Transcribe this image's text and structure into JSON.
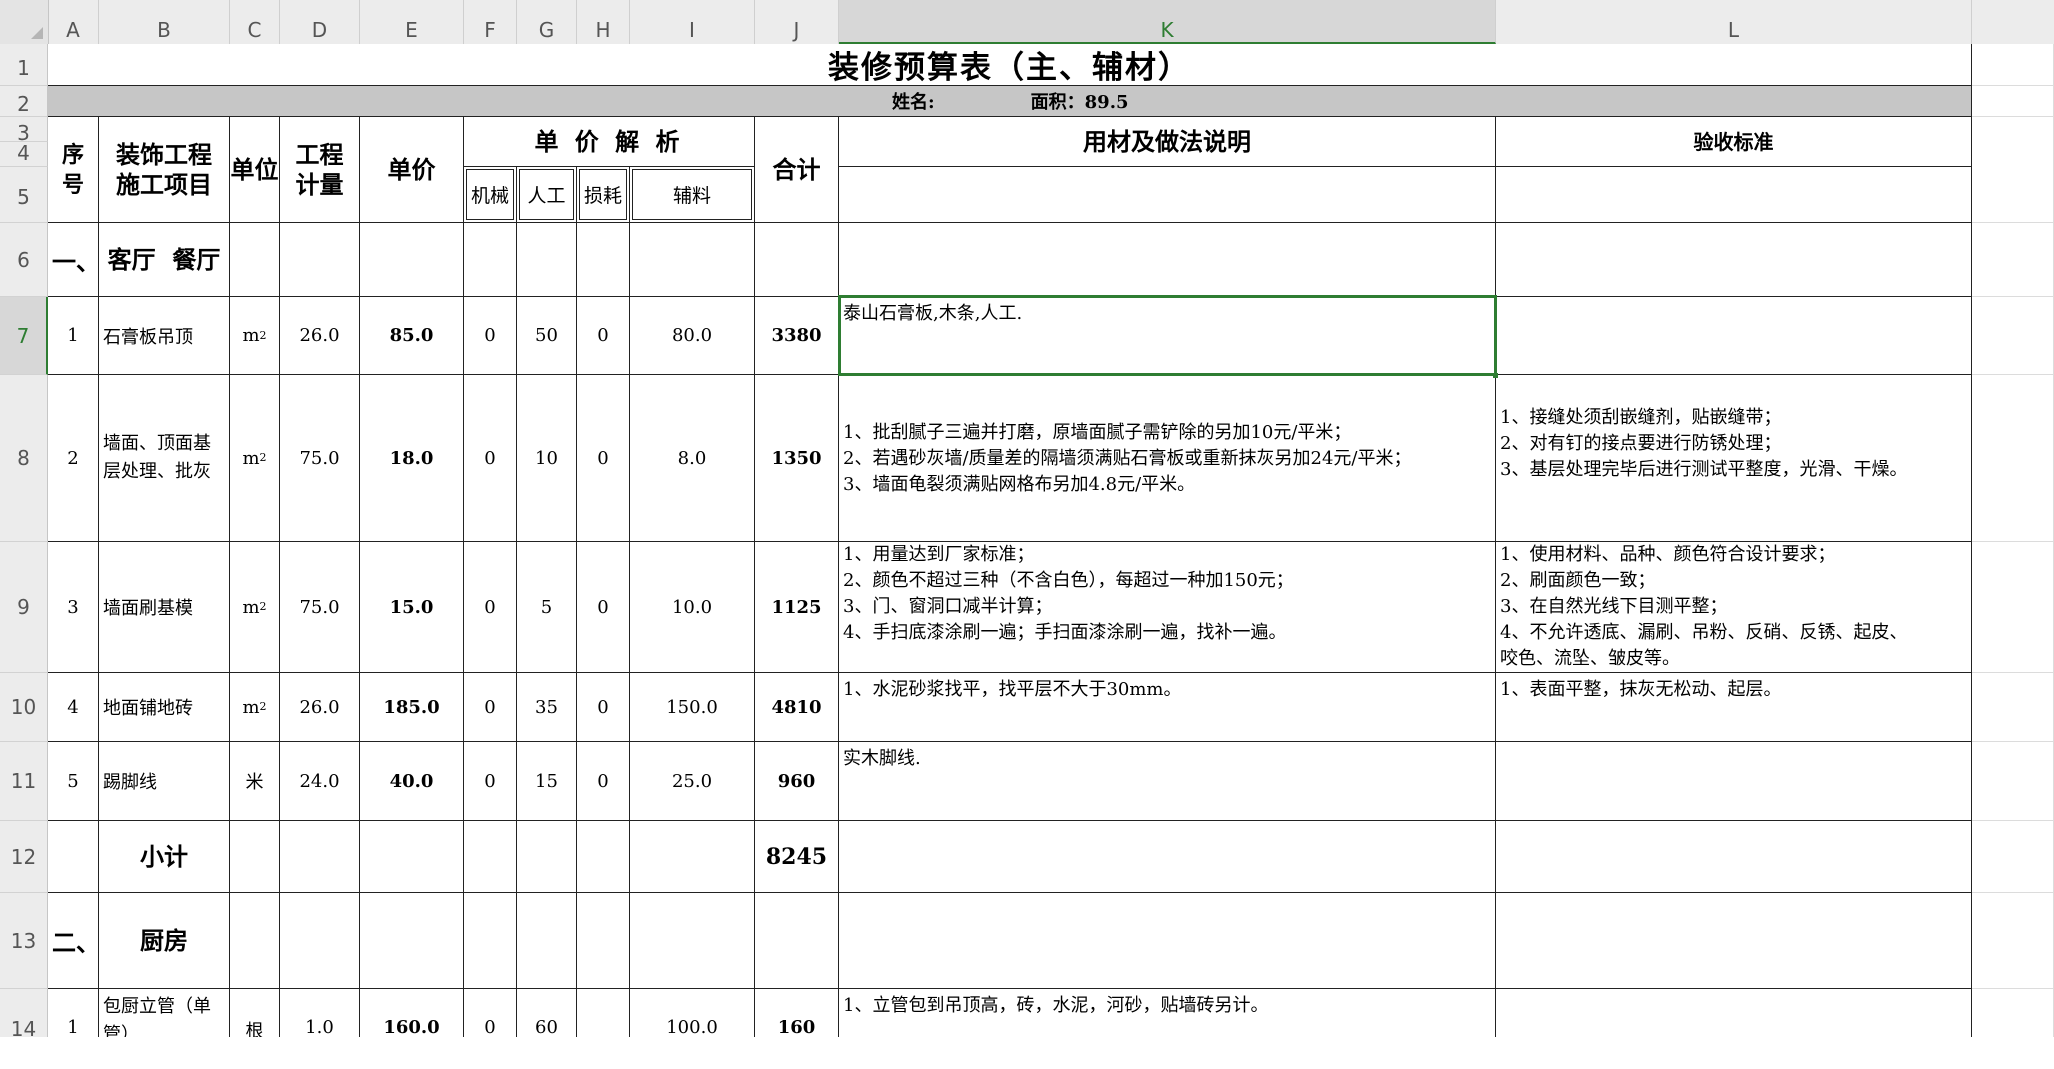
{
  "columns": [
    "A",
    "B",
    "C",
    "D",
    "E",
    "F",
    "G",
    "H",
    "I",
    "J",
    "K",
    "L"
  ],
  "rows": [
    "1",
    "2",
    "3",
    "4",
    "5",
    "6",
    "7",
    "8",
    "9",
    "10",
    "11",
    "12",
    "13",
    "14"
  ],
  "sheet": {
    "title": "装修预算表（主、辅材）",
    "info_name": "姓名:",
    "info_area": "面积：89.5",
    "headers": {
      "seq": "序 号",
      "project": "装饰工程\n施工项目",
      "unit": "单位",
      "qty": "工程\n计量",
      "price": "单价",
      "analysis": "单 价 解 析",
      "machine": "机械",
      "labor": "人工",
      "loss": "损耗",
      "aux": "辅料",
      "total": "合计",
      "notes": "用材及做法说明",
      "acceptance": "验收标准"
    },
    "section1_no": "一、",
    "section1_name": "客厅  餐厅",
    "section2_no": "二、",
    "section2_name": "厨房",
    "subtotal_label": "小计",
    "subtotal_value": "8245",
    "items": [
      {
        "no": "1",
        "name": "石膏板吊顶",
        "unit": "m",
        "unit_sup": "2",
        "qty": "26.0",
        "price": "85.0",
        "machine": "0",
        "labor": "50",
        "loss": "0",
        "aux": "80.0",
        "total": "3380",
        "notes": "泰山石膏板,木条,人工.",
        "acceptance": ""
      },
      {
        "no": "2",
        "name": "墙面、顶面基\n层处理、批灰",
        "unit": "m",
        "unit_sup": "2",
        "qty": "75.0",
        "price": "18.0",
        "machine": "0",
        "labor": "10",
        "loss": "0",
        "aux": "8.0",
        "total": "1350",
        "notes": "1、批刮腻子三遍并打磨，原墙面腻子需铲除的另加10元/平米；\n2、若遇砂灰墙/质量差的隔墙须满贴石膏板或重新抹灰另加24元/平米；\n3、墙面龟裂须满贴网格布另加4.8元/平米。",
        "acceptance": "1、接缝处须刮嵌缝剂，贴嵌缝带；\n2、对有钉的接点要进行防锈处理；\n3、基层处理完毕后进行测试平整度，光滑、干燥。"
      },
      {
        "no": "3",
        "name": "墙面刷基模",
        "unit": "m",
        "unit_sup": "2",
        "qty": "75.0",
        "price": "15.0",
        "machine": "0",
        "labor": "5",
        "loss": "0",
        "aux": "10.0",
        "total": "1125",
        "notes": "1、用量达到厂家标准；\n2、颜色不超过三种（不含白色），每超过一种加150元；\n3、门、窗洞口减半计算；\n4、手扫底漆涂刷一遍；手扫面漆涂刷一遍，找补一遍。",
        "acceptance": "1、使用材料、品种、颜色符合设计要求；\n2、刷面颜色一致；\n3、在自然光线下目测平整；\n4、不允许透底、漏刷、吊粉、反硝、反锈、起皮、\n咬色、流坠、皱皮等。"
      },
      {
        "no": "4",
        "name": "地面铺地砖",
        "unit": "m",
        "unit_sup": "2",
        "qty": "26.0",
        "price": "185.0",
        "machine": "0",
        "labor": "35",
        "loss": "0",
        "aux": "150.0",
        "total": "4810",
        "notes": "1、水泥砂浆找平，找平层不大于30mm。",
        "acceptance": "1、表面平整，抹灰无松动、起层。"
      },
      {
        "no": "5",
        "name": "踢脚线",
        "unit": "米",
        "unit_sup": "",
        "qty": "24.0",
        "price": "40.0",
        "machine": "0",
        "labor": "15",
        "loss": "0",
        "aux": "25.0",
        "total": "960",
        "notes": "实木脚线.",
        "acceptance": ""
      },
      {
        "no": "1",
        "name": "包厨立管（单\n管）",
        "unit": "根",
        "unit_sup": "",
        "qty": "1.0",
        "price": "160.0",
        "machine": "0",
        "labor": "60",
        "loss": "",
        "aux": "100.0",
        "total": "160",
        "notes": "1、立管包到吊顶高，砖，水泥，河砂，贴墙砖另计。",
        "acceptance": ""
      }
    ]
  }
}
